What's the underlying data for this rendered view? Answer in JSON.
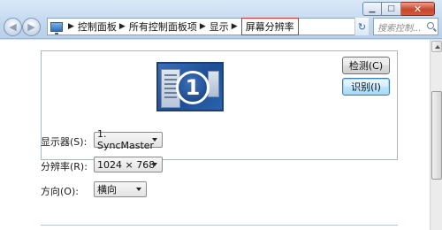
{
  "window": {
    "minimize_glyph": "▁",
    "maximize_glyph": "□",
    "close_glyph": "✕"
  },
  "nav": {
    "back_glyph": "◀",
    "forward_glyph": "▶"
  },
  "address_bar": {
    "icon": "control-panel-icon",
    "separator": "▶",
    "crumbs": [
      "控制面板",
      "所有控制面板项",
      "显示",
      "屏幕分辨率"
    ],
    "dropdown_glyph": "▼",
    "refresh_glyph": "↻"
  },
  "search": {
    "placeholder": "搜索控制..."
  },
  "display_panel": {
    "monitor_number": "1",
    "detect_label": "检测(C)",
    "identify_label": "识别(I)"
  },
  "settings": {
    "display": {
      "label": "显示器(S):",
      "value": "1. SyncMaster"
    },
    "resolution": {
      "label": "分辨率(R):",
      "value": "1024 × 768"
    },
    "orientation": {
      "label": "方向(O):",
      "value": "横向"
    }
  },
  "colors": {
    "highlight_border": "#e0282a",
    "window_chrome": "#c3d8ee"
  }
}
